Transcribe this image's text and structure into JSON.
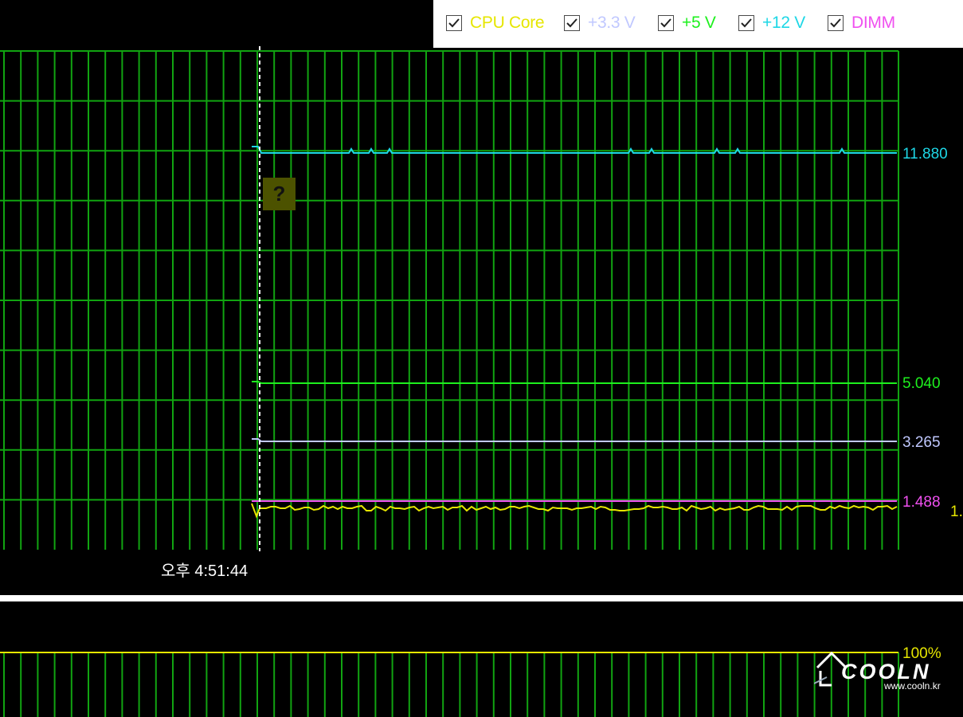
{
  "legend": [
    {
      "label": "CPU Core",
      "color": "#e6e600",
      "checked": true
    },
    {
      "label": "+3.3 V",
      "color": "#c0c8ff",
      "checked": true
    },
    {
      "label": "+5 V",
      "color": "#1ef01e",
      "checked": true
    },
    {
      "label": "+12 V",
      "color": "#1ed7e6",
      "checked": true
    },
    {
      "label": "DIMM",
      "color": "#f050f0",
      "checked": true
    }
  ],
  "readouts": {
    "v12": "11.880",
    "v5": "5.040",
    "v33": "3.265",
    "dimm": "1.488",
    "cpu_core": "1."
  },
  "time_label": "오후 4:51:44",
  "question_mark": "?",
  "lower_graph": {
    "readout": "100%"
  },
  "watermark": {
    "logo": "COOLN",
    "url": "www.cooln.kr"
  },
  "colors": {
    "grid": "#11a411",
    "cursor": "#ffffff",
    "background": "#000000"
  }
}
